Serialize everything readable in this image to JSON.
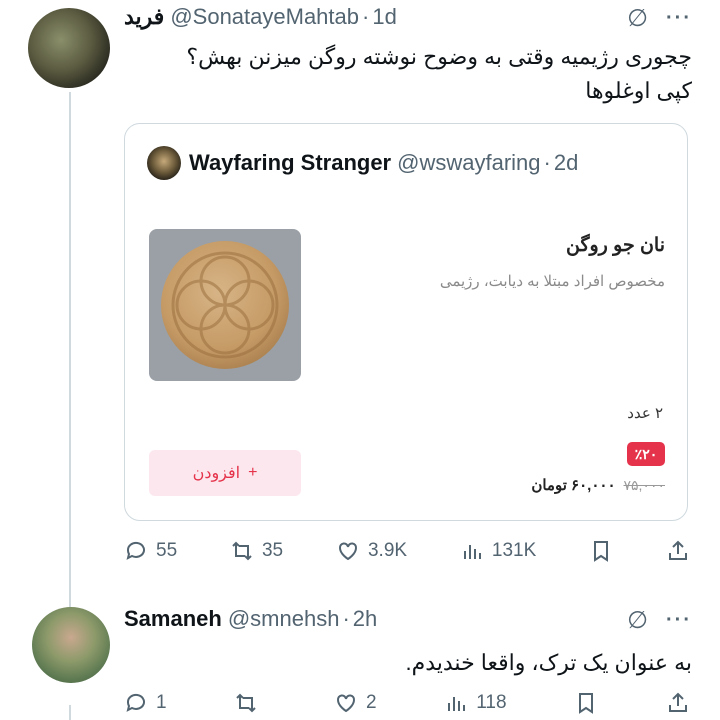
{
  "tweet1": {
    "name": "فرید",
    "handle": "@SonatayeMahtab",
    "time": "1d",
    "text_line1": "چجوری رژیمیه وقتی به وضوح نوشته روگن میزنن بهش؟",
    "text_line2": "کپی اوغلوها",
    "replies": "55",
    "retweets": "35",
    "likes": "3.9K",
    "views": "131K"
  },
  "quote": {
    "name": "Wayfaring Stranger",
    "handle": "@wswayfaring",
    "time": "2d",
    "product_title": "نان جو روگن",
    "product_desc": "مخصوص افراد مبتلا به دیابت، رژیمی",
    "quantity": "۲ عدد",
    "discount": "٪۲۰",
    "price": "۶۰,۰۰۰ تومان",
    "old_price": "۷۵,۰۰۰",
    "add_label": "افزودن",
    "add_icon": "+"
  },
  "tweet2": {
    "name": "Samaneh",
    "handle": "@smnehsh",
    "time": "2h",
    "text": "به عنوان یک ترک، واقعا خندیدم.",
    "replies": "1",
    "retweets": "",
    "likes": "2",
    "views": "118"
  },
  "ui": {
    "dot": "·",
    "more": "···",
    "grok_icon": "∅"
  },
  "colors": {
    "accent_red": "#e5334b",
    "muted": "#536471",
    "border": "#cfd9de"
  }
}
